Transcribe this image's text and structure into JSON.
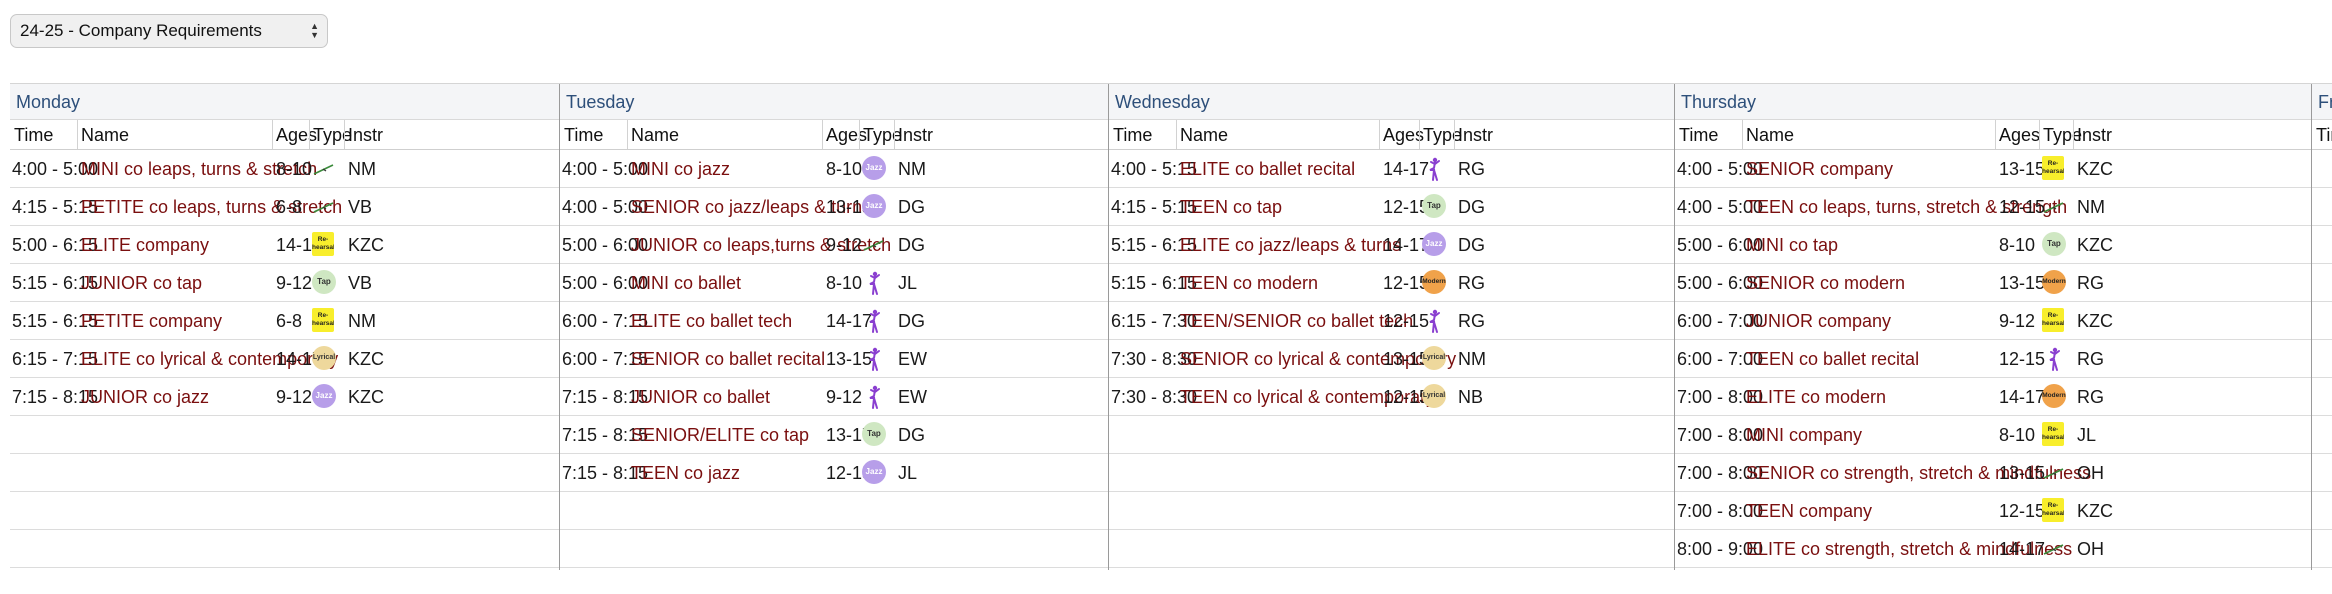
{
  "selector": {
    "value": "24-25 - Company Requirements"
  },
  "columns": {
    "time": "Time",
    "name": "Name",
    "ages": "Ages",
    "type": "Type",
    "instr": "Instr"
  },
  "type_icons": {
    "ballet": {
      "icon": "ballerina-icon",
      "color": "#8a3fd0"
    },
    "leaps": {
      "icon": "leap-line-icon",
      "color": "#3a8a3a"
    }
  },
  "days": [
    {
      "day": "Monday",
      "rows": [
        {
          "time": "4:00 - 5:00",
          "name": "MINI co leaps, turns & stretch",
          "ages": "8-10",
          "type": "leaps",
          "instr": "NM"
        },
        {
          "time": "4:15 - 5:15",
          "name": "PETITE co leaps, turns & stretch",
          "ages": "6-8",
          "type": "leaps",
          "instr": "VB"
        },
        {
          "time": "5:00 - 6:15",
          "name": "ELITE company",
          "ages": "14-17",
          "type": "rehearsal",
          "type_label": "Re-hearsal",
          "instr": "KZC"
        },
        {
          "time": "5:15 - 6:15",
          "name": "JUNIOR co tap",
          "ages": "9-12",
          "type": "tap",
          "type_label": "Tap",
          "instr": "VB"
        },
        {
          "time": "5:15 - 6:15",
          "name": "PETITE company",
          "ages": "6-8",
          "type": "rehearsal",
          "type_label": "Re-hearsal",
          "instr": "NM"
        },
        {
          "time": "6:15 - 7:15",
          "name": "ELITE co lyrical & contemporary",
          "ages": "14-17",
          "type": "lyrical",
          "type_label": "Lyrical",
          "instr": "KZC"
        },
        {
          "time": "7:15 - 8:15",
          "name": "JUNIOR co jazz",
          "ages": "9-12",
          "type": "jazz",
          "type_label": "Jazz",
          "instr": "KZC"
        }
      ]
    },
    {
      "day": "Tuesday",
      "rows": [
        {
          "time": "4:00 - 5:00",
          "name": "MINI co jazz",
          "ages": "8-10",
          "type": "jazz",
          "type_label": "Jazz",
          "instr": "NM"
        },
        {
          "time": "4:00 - 5:00",
          "name": "SENIOR co jazz/leaps & turns",
          "ages": "13-15",
          "type": "jazz",
          "type_label": "Jazz",
          "instr": "DG"
        },
        {
          "time": "5:00 - 6:00",
          "name": "JUNIOR co leaps,turns & stretch",
          "ages": "9-12",
          "type": "leaps",
          "instr": "DG"
        },
        {
          "time": "5:00 - 6:00",
          "name": "MINI co ballet",
          "ages": "8-10",
          "type": "ballet",
          "instr": "JL"
        },
        {
          "time": "6:00 - 7:15",
          "name": "ELITE co ballet tech",
          "ages": "14-17",
          "type": "ballet",
          "instr": "DG"
        },
        {
          "time": "6:00 - 7:15",
          "name": "SENIOR co ballet recital",
          "ages": "13-15",
          "type": "ballet",
          "instr": "EW"
        },
        {
          "time": "7:15 - 8:15",
          "name": "JUNIOR co ballet",
          "ages": "9-12",
          "type": "ballet",
          "instr": "EW"
        },
        {
          "time": "7:15 - 8:15",
          "name": "SENIOR/ELITE co tap",
          "ages": "13-17",
          "type": "tap",
          "type_label": "Tap",
          "instr": "DG"
        },
        {
          "time": "7:15 - 8:15",
          "name": "TEEN co jazz",
          "ages": "12-15",
          "type": "jazz",
          "type_label": "Jazz",
          "instr": "JL"
        }
      ]
    },
    {
      "day": "Wednesday",
      "rows": [
        {
          "time": "4:00 - 5:15",
          "name": "ELITE co ballet recital",
          "ages": "14-17",
          "type": "ballet",
          "instr": "RG"
        },
        {
          "time": "4:15 - 5:15",
          "name": "TEEN co tap",
          "ages": "12-15",
          "type": "tap",
          "type_label": "Tap",
          "instr": "DG"
        },
        {
          "time": "5:15 - 6:15",
          "name": "ELITE co jazz/leaps & turns",
          "ages": "14-17",
          "type": "jazz",
          "type_label": "Jazz",
          "instr": "DG"
        },
        {
          "time": "5:15 - 6:15",
          "name": "TEEN co modern",
          "ages": "12-15",
          "type": "modern",
          "type_label": "Modern",
          "instr": "RG"
        },
        {
          "time": "6:15 - 7:30",
          "name": "TEEN/SENIOR co ballet tech",
          "ages": "12-15",
          "type": "ballet",
          "instr": "RG"
        },
        {
          "time": "7:30 - 8:30",
          "name": "SENIOR co lyrical & contemporary",
          "ages": "13-15",
          "type": "lyrical",
          "type_label": "Lyrical",
          "instr": "NM"
        },
        {
          "time": "7:30 - 8:30",
          "name": "TEEN co lyrical & contemporary",
          "ages": "12-15",
          "type": "lyrical",
          "type_label": "Lyrical",
          "instr": "NB"
        }
      ]
    },
    {
      "day": "Thursday",
      "rows": [
        {
          "time": "4:00 - 5:00",
          "name": "SENIOR company",
          "ages": "13-15",
          "type": "rehearsal",
          "type_label": "Re-hearsal",
          "instr": "KZC"
        },
        {
          "time": "4:00 - 5:00",
          "name": "TEEN co leaps, turns, stretch & strength",
          "ages": "12-15",
          "type": "leaps",
          "instr": "NM"
        },
        {
          "time": "5:00 - 6:00",
          "name": "MINI co tap",
          "ages": "8-10",
          "type": "tap",
          "type_label": "Tap",
          "instr": "KZC"
        },
        {
          "time": "5:00 - 6:00",
          "name": "SENIOR co modern",
          "ages": "13-15",
          "type": "modern",
          "type_label": "Modern",
          "instr": "RG"
        },
        {
          "time": "6:00 - 7:00",
          "name": "JUNIOR company",
          "ages": "9-12",
          "type": "rehearsal",
          "type_label": "Re-hearsal",
          "instr": "KZC"
        },
        {
          "time": "6:00 - 7:00",
          "name": "TEEN co ballet recital",
          "ages": "12-15",
          "type": "ballet",
          "instr": "RG"
        },
        {
          "time": "7:00 - 8:00",
          "name": "ELITE co modern",
          "ages": "14-17",
          "type": "modern",
          "type_label": "Modern",
          "instr": "RG"
        },
        {
          "time": "7:00 - 8:00",
          "name": "MINI company",
          "ages": "8-10",
          "type": "rehearsal",
          "type_label": "Re-hearsal",
          "instr": "JL"
        },
        {
          "time": "7:00 - 8:00",
          "name": "SENIOR co strength, stretch & mindfulness",
          "ages": "13-15",
          "type": "leaps",
          "instr": "OH"
        },
        {
          "time": "7:00 - 8:00",
          "name": "TEEN company",
          "ages": "12-15",
          "type": "rehearsal",
          "type_label": "Re-hearsal",
          "instr": "KZC"
        },
        {
          "time": "8:00 - 9:00",
          "name": "ELITE co strength, stretch & mindfulness",
          "ages": "14-17",
          "type": "leaps",
          "instr": "OH"
        }
      ]
    },
    {
      "day": "Fr",
      "partial": true,
      "rows": []
    }
  ]
}
